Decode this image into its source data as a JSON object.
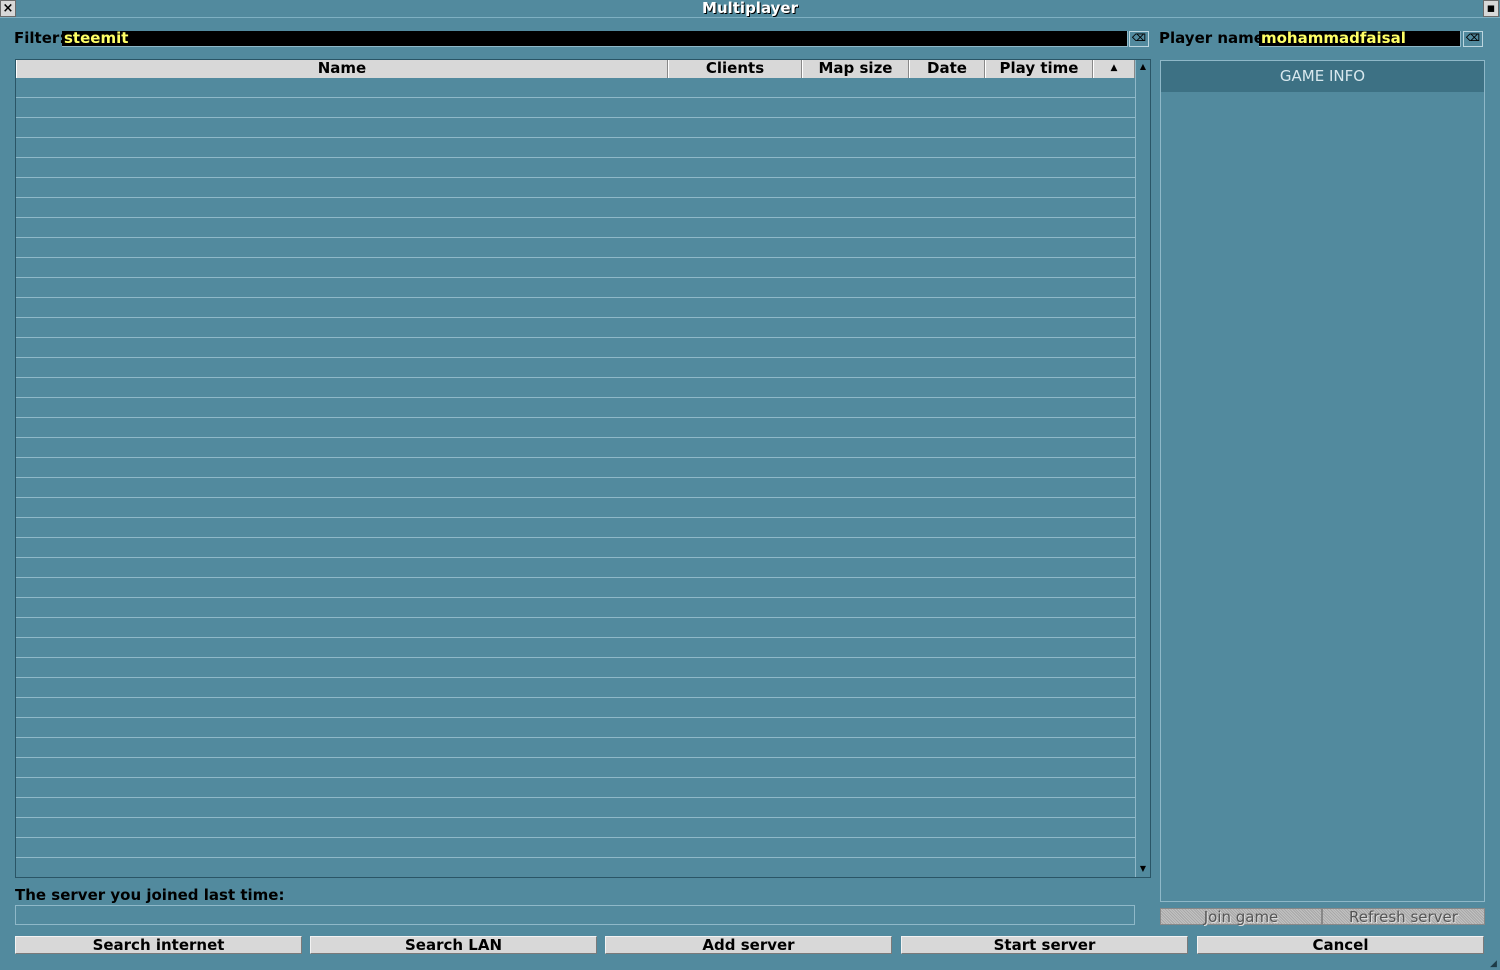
{
  "window": {
    "title": "Multiplayer",
    "close_glyph": "×",
    "menu_glyph": "▪"
  },
  "filter": {
    "label": "Filter:",
    "value": "steemit",
    "clear_glyph": "⌫"
  },
  "player": {
    "label": "Player name:",
    "value": "mohammadfaisal",
    "clear_glyph": "⌫"
  },
  "server_list": {
    "columns": [
      "Name",
      "Clients",
      "Map size",
      "Date",
      "Play time"
    ],
    "sort_glyph": "▲",
    "row_count": 39,
    "rows": [],
    "scroll_up_glyph": "▲",
    "scroll_down_glyph": "▼"
  },
  "game_info": {
    "title": "GAME INFO",
    "join_label": "Join game",
    "refresh_label": "Refresh server"
  },
  "last_server": {
    "label": "The server you joined last time:",
    "value": ""
  },
  "buttons": {
    "search_internet": "Search internet",
    "search_lan": "Search LAN",
    "add_server": "Add server",
    "start_server": "Start server",
    "cancel": "Cancel"
  },
  "colors": {
    "background": "#528a9e",
    "edit_text": "#ffff66",
    "panel_title_bg": "#3d7184"
  }
}
